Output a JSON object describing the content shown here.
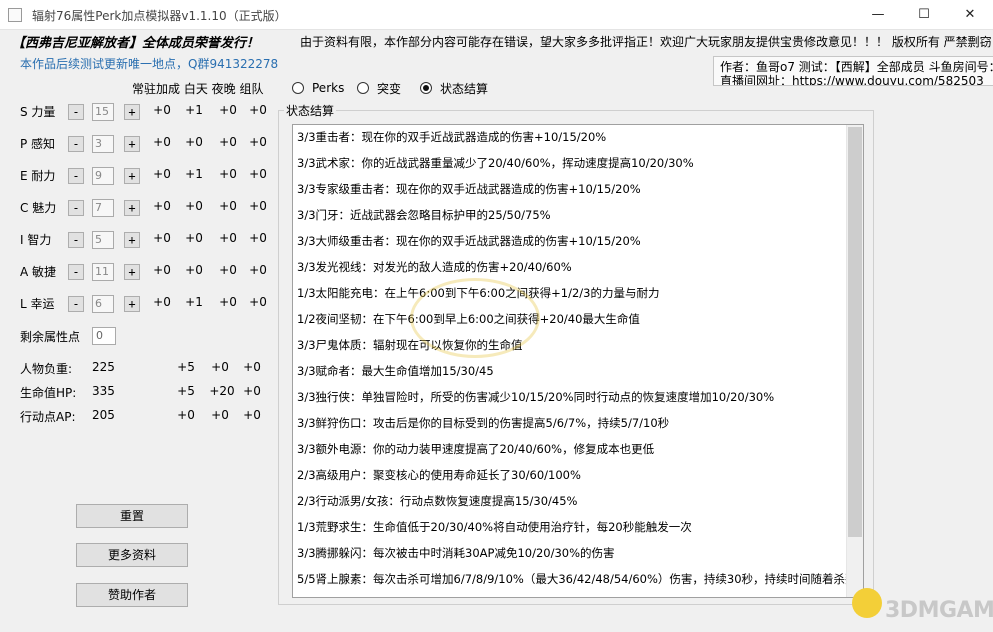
{
  "window": {
    "title": "辐射76属性Perk加点模拟器v1.1.10（正式版）",
    "min_icon": "minimize-icon",
    "max_icon": "maximize-icon",
    "close_icon": "close-icon"
  },
  "banner": {
    "left": "【西弗吉尼亚解放者】全体成员荣誉发行！",
    "right": "由于资料有限，本作部分内容可能存在错误，望大家多多批评指正！欢迎广大玩家朋友提供宝贵修改意见！！！ 版权所有 严禁剽窃"
  },
  "update_note": "本作品后续测试更新唯一地点，Q群941322278",
  "headers": {
    "bonus": "常驻加成 白天 夜晚 组队"
  },
  "author": {
    "line1": "作者：鱼哥o7 测试：【西解】全部成员 斗鱼房间号：",
    "line2": "直播间网址：https://www.douyu.com/582503"
  },
  "modes": [
    {
      "label": "Perks",
      "selected": false
    },
    {
      "label": "突变",
      "selected": false
    },
    {
      "label": "状态结算",
      "selected": true
    }
  ],
  "stats": [
    {
      "label": "S 力量",
      "value": "15",
      "bonus": [
        "+0",
        "+1",
        "+0",
        "+0"
      ]
    },
    {
      "label": "P 感知",
      "value": "3",
      "bonus": [
        "+0",
        "+0",
        "+0",
        "+0"
      ]
    },
    {
      "label": "E 耐力",
      "value": "9",
      "bonus": [
        "+0",
        "+1",
        "+0",
        "+0"
      ]
    },
    {
      "label": "C 魅力",
      "value": "7",
      "bonus": [
        "+0",
        "+0",
        "+0",
        "+0"
      ]
    },
    {
      "label": "I 智力",
      "value": "5",
      "bonus": [
        "+0",
        "+0",
        "+0",
        "+0"
      ]
    },
    {
      "label": "A 敏捷",
      "value": "11",
      "bonus": [
        "+0",
        "+0",
        "+0",
        "+0"
      ]
    },
    {
      "label": "L 幸运",
      "value": "6",
      "bonus": [
        "+0",
        "+1",
        "+0",
        "+0"
      ]
    }
  ],
  "minus_label": "-",
  "plus_label": "+",
  "remaining": {
    "label": "剩余属性点",
    "value": "0"
  },
  "derived": [
    {
      "label": "人物负重:",
      "value": "225",
      "bonus": [
        "+5",
        "+0",
        "+0"
      ]
    },
    {
      "label": "生命值HP:",
      "value": "335",
      "bonus": [
        "+5",
        "+20",
        "+0"
      ]
    },
    {
      "label": "行动点AP:",
      "value": "205",
      "bonus": [
        "+0",
        "+0",
        "+0"
      ]
    }
  ],
  "buttons": {
    "reset": "重置",
    "more": "更多资料",
    "donate": "赞助作者"
  },
  "results_title": "状态结算",
  "results": [
    "3/3重击者：现在你的双手近战武器造成的伤害+10/15/20%",
    "3/3武术家：你的近战武器重量减少了20/40/60%，挥动速度提高10/20/30%",
    "3/3专家级重击者：现在你的双手近战武器造成的伤害+10/15/20%",
    "3/3门牙：近战武器会忽略目标护甲的25/50/75%",
    "3/3大师级重击者：现在你的双手近战武器造成的伤害+10/15/20%",
    "3/3发光视线：对发光的敌人造成的伤害+20/40/60%",
    "1/3太阳能充电：在上午6:00到下午6:00之间获得+1/2/3的力量与耐力",
    "1/2夜间坚韧：在下午6:00到早上6:00之间获得+20/40最大生命值",
    "3/3尸鬼体质：辐射现在可以恢复你的生命值",
    "3/3赋命者：最大生命值增加15/30/45",
    "3/3独行侠：单独冒险时，所受的伤害减少10/15/20%同时行动点的恢复速度增加10/20/30%",
    "3/3鲜狩伤口：攻击后是你的目标受到的伤害提高5/6/7%，持续5/7/10秒",
    "3/3额外电源：你的动力装甲速度提高了20/40/60%，修复成本也更低",
    "2/3高级用户：聚变核心的使用寿命延长了30/60/100%",
    "2/3行动派男/女孩：行动点数恢复速度提高15/30/45%",
    "1/3荒野求生：生命值低于20/30/40%将自动使用治疗针，每20秒能触发一次",
    "3/3腾挪躲闪：每次被击中时消耗30AP减免10/20/30%的伤害",
    "5/5肾上腺素：每次击杀可增加6/7/8/9/10%（最大36/42/48/54/60%）伤害，持续30秒，持续时间随着杀戮"
  ],
  "watermark": "3DMGAME"
}
